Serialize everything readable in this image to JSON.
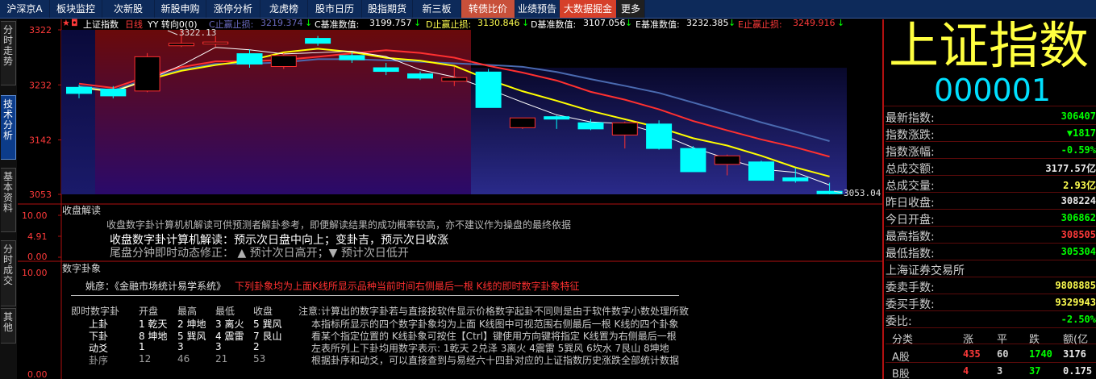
{
  "topbar": {
    "tabs": [
      {
        "label": "沪深京A"
      },
      {
        "label": "板块监控"
      },
      {
        "label": "次新股"
      },
      {
        "label": "新股申购"
      },
      {
        "label": "涨停分析"
      },
      {
        "label": "龙虎榜"
      },
      {
        "label": "股市日历"
      },
      {
        "label": "股指期货"
      },
      {
        "label": "新三板"
      },
      {
        "label": "转债比价"
      },
      {
        "label": "业绩预告"
      },
      {
        "label": "大数据掘金"
      },
      {
        "label": "更多"
      }
    ]
  },
  "lefttabs": [
    "分时走势",
    "技术分析",
    "基本资料",
    "分时成交",
    "其他"
  ],
  "chart": {
    "title": "上证指数",
    "period": "日线",
    "indicator": "YY 转向0(0)",
    "c_label": "C止赢止损:",
    "c_value": "3219.374",
    "cbase_label": "C基准数值:",
    "cbase_value": "3199.757",
    "d_label": "D止赢止损:",
    "d_value": "3130.846",
    "dbase_label": "D基准数值:",
    "dbase_value": "3107.056",
    "ebase_label": "E基准数值:",
    "ebase_value": "3232.385",
    "e_label": "E止赢止损:",
    "e_value": "3249.916",
    "high_marker": "3322.13",
    "low_marker": "3053.04",
    "y_ticks": [
      "3322",
      "3232",
      "3142",
      "3053"
    ],
    "colors": {
      "up": "#ff3030",
      "down": "#00ffff",
      "ma5": "#ffffff",
      "ma10": "#ffff00",
      "ma20": "#ff3030",
      "ma60": "#4a6ab0"
    }
  },
  "candles": [
    {
      "o": 3218,
      "c": 3228,
      "h": 3232,
      "l": 3210,
      "up": false
    },
    {
      "o": 3225,
      "c": 3214,
      "h": 3230,
      "l": 3210,
      "up": false
    },
    {
      "o": 3222,
      "c": 3278,
      "h": 3284,
      "l": 3220,
      "up": true
    },
    {
      "o": 3296,
      "c": 3300,
      "h": 3322,
      "l": 3294,
      "up": true
    },
    {
      "o": 3299,
      "c": 3302,
      "h": 3312,
      "l": 3294,
      "up": true
    },
    {
      "o": 3283,
      "c": 3266,
      "h": 3290,
      "l": 3260,
      "up": false
    },
    {
      "o": 3262,
      "c": 3280,
      "h": 3284,
      "l": 3258,
      "up": true
    },
    {
      "o": 3300,
      "c": 3308,
      "h": 3312,
      "l": 3296,
      "up": false
    },
    {
      "o": 3280,
      "c": 3273,
      "h": 3286,
      "l": 3268,
      "up": false
    },
    {
      "o": 3260,
      "c": 3254,
      "h": 3268,
      "l": 3248,
      "up": false
    },
    {
      "o": 3250,
      "c": 3243,
      "h": 3254,
      "l": 3240,
      "up": false
    },
    {
      "o": 3244,
      "c": 3238,
      "h": 3262,
      "l": 3230,
      "up": true
    },
    {
      "o": 3253,
      "c": 3195,
      "h": 3258,
      "l": 3195,
      "up": false
    },
    {
      "o": 3162,
      "c": 3178,
      "h": 3178,
      "l": 3160,
      "up": true
    },
    {
      "o": 3180,
      "c": 3176,
      "h": 3182,
      "l": 3160,
      "up": false
    },
    {
      "o": 3170,
      "c": 3160,
      "h": 3176,
      "l": 3158,
      "up": false
    },
    {
      "o": 3150,
      "c": 3170,
      "h": 3172,
      "l": 3128,
      "up": true
    },
    {
      "o": 3168,
      "c": 3128,
      "h": 3174,
      "l": 3126,
      "up": false
    },
    {
      "o": 3128,
      "c": 3090,
      "h": 3132,
      "l": 3090,
      "up": false
    },
    {
      "o": 3102,
      "c": 3116,
      "h": 3118,
      "l": 3084,
      "up": true
    },
    {
      "o": 3106,
      "c": 3076,
      "h": 3108,
      "l": 3076,
      "up": false
    },
    {
      "o": 3080,
      "c": 3075,
      "h": 3096,
      "l": 3072,
      "up": false
    },
    {
      "o": 3058,
      "c": 3054,
      "h": 3072,
      "l": 3053,
      "up": false
    }
  ],
  "panel2": {
    "title": "收盘解读",
    "ticks": [
      "10.00",
      "4.91",
      "0.00"
    ],
    "line1": "收盘数字卦计算机机解读可供预测者解卦参考，即便解读结果的成功概率较高，亦不建议作为操盘的最终依据",
    "line2": "收盘数字卦计算机解读：预示次日盘中向上；变卦吉，预示次日收涨",
    "line3": "尾盘分钟即时动态修正：  ▲ 预计次日高开；▼ 预计次日低开"
  },
  "panel3": {
    "title": "数字卦象",
    "ticks": [
      "10.00",
      "0.00"
    ],
    "yao_label": "姚彦：《金融市场统计易学系统》",
    "yao_red": "下列卦象均为上面K线所显示品种当前时间右侧最后一根 K线的即时数字卦象特征",
    "table_head": [
      "即时数字卦",
      "开盘",
      "最高",
      "最低",
      "收盘"
    ],
    "rows": [
      [
        "上卦",
        "1 乾天",
        "3 离火",
        "5 巽风"
      ],
      [
        "下卦",
        "8 坤地",
        "5 巽风",
        "4 震雷",
        "7 艮山"
      ],
      [
        "动爻",
        "1",
        "3",
        "3",
        "2"
      ],
      [
        "卦序",
        "12",
        "46",
        "21",
        "53"
      ]
    ],
    "row1_open": "1 乾天",
    "row1_high": "2 坤地",
    "note1": "注意:计算出的数字卦若与直接按软件显示价格数字起卦不同则是由于软件数字小数处理所致",
    "note2": "本指标所显示的四个数字卦象均为上面 K线图中可视范围右侧最后一根 K线的四个卦象",
    "note3": "看某个指定位置的 K线卦象可按住【Ctrl】键使用方向键将指定 K线置为右侧最后一根",
    "note4": "左表所列上下卦均用数字表示: 1乾天 2兑泽 3离火 4震雷 5巽风 6坎水 7艮山 8坤地",
    "note5": "根据卦序和动爻，可以直接查到与易经六十四卦对应的上证指数历史涨跌全部统计数据"
  },
  "right": {
    "name": "上证指数",
    "code": "000001",
    "rows": [
      {
        "k": "最新指数:",
        "v": "306407",
        "c": "green"
      },
      {
        "k": "指数涨跌:",
        "v": "▼1817",
        "c": "green"
      },
      {
        "k": "指数涨幅:",
        "v": "-0.59%",
        "c": "green"
      },
      {
        "k": "总成交额:",
        "v": "3177.57亿",
        "c": "white"
      },
      {
        "k": "总成交量:",
        "v": "2.93亿",
        "c": "yellow"
      },
      {
        "k": "昨日收盘:",
        "v": "308224",
        "c": "white"
      },
      {
        "k": "今日开盘:",
        "v": "306862",
        "c": "green"
      },
      {
        "k": "最高指数:",
        "v": "308505",
        "c": "red"
      },
      {
        "k": "最低指数:",
        "v": "305304",
        "c": "green"
      }
    ],
    "exchange": "上海证券交易所",
    "rows2": [
      {
        "k": "委卖手数:",
        "v": "9808885",
        "c": "yellow"
      },
      {
        "k": "委买手数:",
        "v": "9329943",
        "c": "yellow"
      },
      {
        "k": "委比:",
        "v": "-2.50%",
        "c": "green"
      }
    ],
    "table_head": [
      "分类",
      "涨",
      "平",
      "跌",
      "额(亿"
    ],
    "table_rows": [
      {
        "name": "A股",
        "up": "435",
        "flat": "60",
        "down": "1740",
        "amt": "3176"
      },
      {
        "name": "B股",
        "up": "4",
        "flat": "3",
        "down": "37",
        "amt": "0.175"
      }
    ]
  }
}
